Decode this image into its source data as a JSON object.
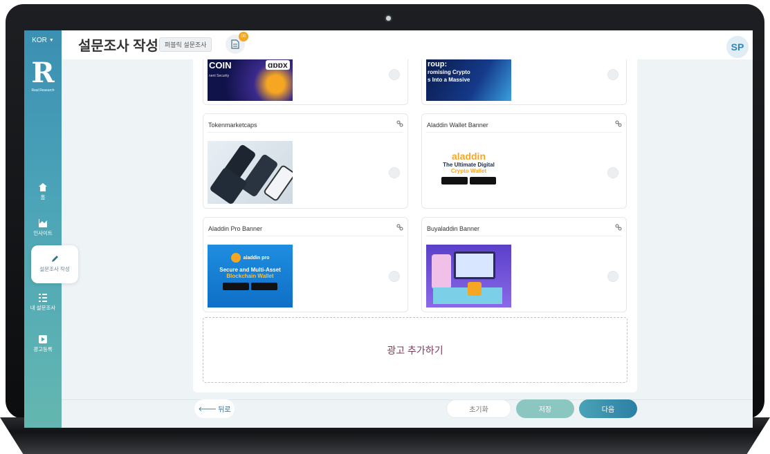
{
  "sidebar": {
    "language": "KOR",
    "logo_text": "Real Research",
    "items": [
      {
        "label": "홈",
        "icon": "home-icon"
      },
      {
        "label": "인사이트",
        "icon": "insight-chart-icon"
      },
      {
        "label": "설문조사 작성",
        "icon": "pencil-icon"
      },
      {
        "label": "내 설문조사",
        "icon": "list-icon"
      },
      {
        "label": "광고등록",
        "icon": "play-icon"
      }
    ]
  },
  "header": {
    "title": "설문조사 작성",
    "badge": "퍼블릭 설문조사",
    "doc_count": "00",
    "avatar": "SP"
  },
  "cards": [
    {
      "title": "",
      "image_lines": [
        "COIN",
        "nent Security"
      ],
      "image_logo": "ɑɒɒx"
    },
    {
      "title": "",
      "image_lines": [
        "roup:",
        "romising Crypto",
        "s Into a Massive"
      ]
    },
    {
      "title": "Tokenmarketcaps"
    },
    {
      "title": "Aladdin Wallet Banner",
      "image_logo": "aladdin",
      "image_lines": [
        "The Ultimate Digital",
        "Crypto Wallet"
      ]
    },
    {
      "title": "Aladdin Pro Banner",
      "image_logo": "aladdin pro",
      "image_lines": [
        "Secure and Multi-Asset",
        "Blockchain Wallet"
      ]
    },
    {
      "title": "Buyaladdin Banner"
    }
  ],
  "add_ad": "광고 추가하기",
  "footer": {
    "back": "뒤로",
    "reset": "초기화",
    "save": "저장",
    "next": "다음"
  },
  "colors": {
    "sidebar_top": "#3b8fb2",
    "sidebar_bottom": "#64b7b0",
    "accent": "#2c7fa5",
    "badge_orange": "#f5a623"
  }
}
